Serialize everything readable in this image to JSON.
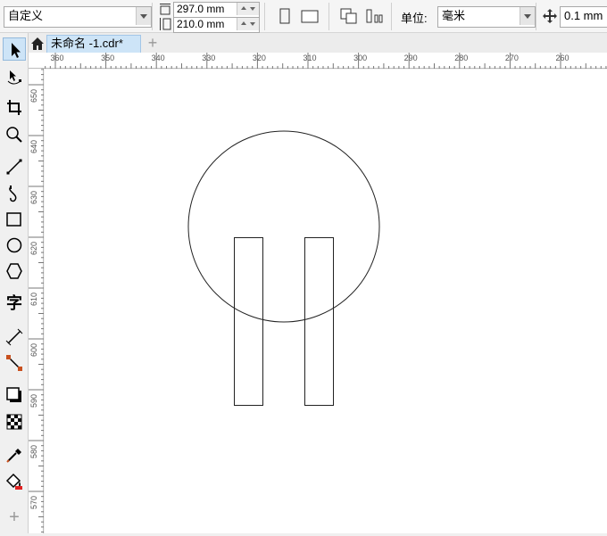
{
  "propbar": {
    "preset_value": "自定义",
    "width_value": "297.0 mm",
    "height_value": "210.0 mm",
    "units_label": "单位:",
    "units_value": "毫米",
    "nudge_value": "0.1 mm"
  },
  "document": {
    "tab_label": "未命名 -1.cdr*",
    "add_tab_label": "+"
  },
  "rulers": {
    "horizontal_ticks": [
      "360",
      "350",
      "340",
      "330",
      "320",
      "310",
      "300",
      "290",
      "280",
      "270",
      "260"
    ],
    "vertical_ticks": [
      "650",
      "640",
      "630",
      "620",
      "610",
      "600",
      "590",
      "580",
      "570"
    ]
  },
  "toolbox": {
    "tools": [
      {
        "name": "pick-tool",
        "icon": "arrow-pointer-icon"
      },
      {
        "name": "shape-tool",
        "icon": "node-edit-icon"
      },
      {
        "name": "crop-tool",
        "icon": "crop-icon"
      },
      {
        "name": "zoom-tool",
        "icon": "magnifier-icon"
      },
      {
        "name": "freehand-tool",
        "icon": "line-icon"
      },
      {
        "name": "artistic-media-tool",
        "icon": "curve-icon"
      },
      {
        "name": "rectangle-tool",
        "icon": "rectangle-icon"
      },
      {
        "name": "ellipse-tool",
        "icon": "ellipse-icon"
      },
      {
        "name": "polygon-tool",
        "icon": "hexagon-icon"
      },
      {
        "name": "text-tool",
        "icon": "text-icon"
      },
      {
        "name": "dimension-tool",
        "icon": "dimension-icon"
      },
      {
        "name": "connector-tool",
        "icon": "connector-icon"
      },
      {
        "name": "shadow-tool",
        "icon": "shadow-icon"
      },
      {
        "name": "transparency-tool",
        "icon": "checker-icon"
      },
      {
        "name": "eyedropper-tool",
        "icon": "eyedropper-icon"
      },
      {
        "name": "fill-tool",
        "icon": "bucket-icon"
      },
      {
        "name": "add-tool",
        "icon": "plus-icon"
      }
    ],
    "text_tool_glyph": "字"
  },
  "colors": {
    "accent": "#cde4f7",
    "connector_node": "#c8501e",
    "fill_red": "#e02020"
  }
}
